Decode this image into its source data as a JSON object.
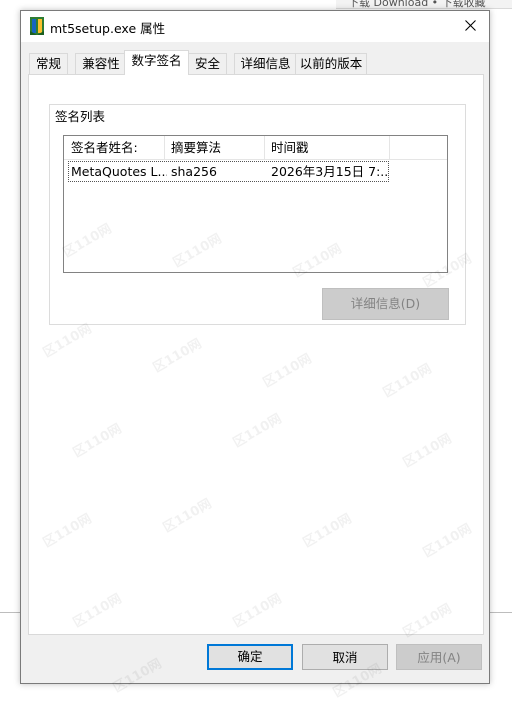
{
  "background": {
    "strip_text": "下载 Download  • 下载收藏"
  },
  "dialog": {
    "title": "mt5setup.exe 属性"
  },
  "tabs": [
    {
      "label": "常规"
    },
    {
      "label": "兼容性"
    },
    {
      "label": "数字签名"
    },
    {
      "label": "安全"
    },
    {
      "label": "详细信息"
    },
    {
      "label": "以前的版本"
    }
  ],
  "signatures": {
    "group_label": "签名列表",
    "columns": [
      "签名者姓名:",
      "摘要算法",
      "时间戳"
    ],
    "rows": [
      [
        "MetaQuotes L...",
        "sha256",
        "2026年3月15日 7:..."
      ]
    ],
    "details_button": "详细信息(D)"
  },
  "footer": {
    "ok": "确定",
    "cancel": "取消",
    "apply": "应用(A)"
  },
  "watermark_text": "区110网",
  "colors": {
    "accent": "#0078d7",
    "dialog_bg": "#f0f0f0",
    "disabled_button": "#cccccc"
  }
}
